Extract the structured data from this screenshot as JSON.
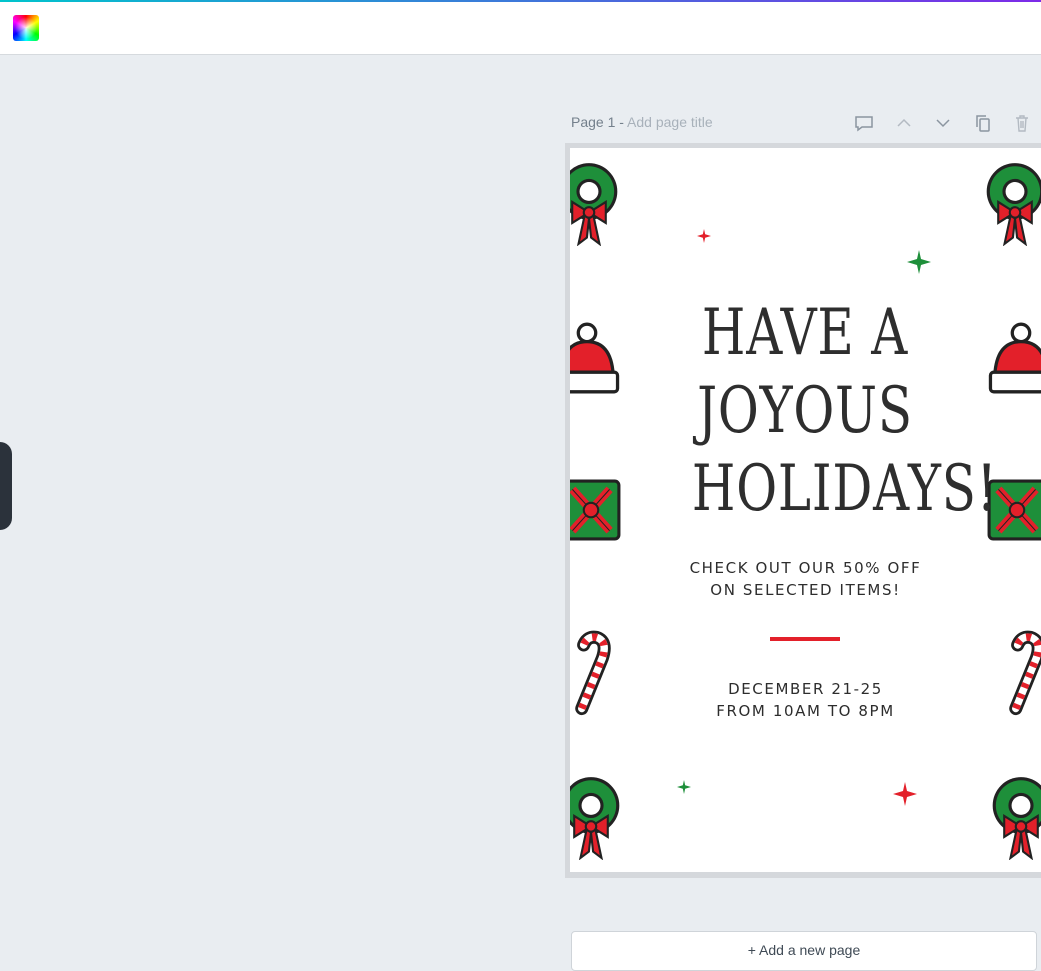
{
  "topbar": {
    "logo_icon": "color-swatch-logo",
    "accent_colors": [
      "#00c4cc",
      "#7d2ae8"
    ]
  },
  "page_header": {
    "page_label": "Page 1 - ",
    "title_placeholder": "Add page title",
    "actions": [
      "comment-icon",
      "move-up-icon",
      "move-down-icon",
      "duplicate-icon",
      "delete-icon"
    ]
  },
  "design": {
    "headline_lines": [
      "HAVE A",
      "JOYOUS",
      "HOLIDAYS!"
    ],
    "offer_lines": [
      "CHECK OUT OUR 50% OFF",
      "ON SELECTED ITEMS!"
    ],
    "date_lines": [
      "DECEMBER 21-25",
      "FROM 10AM TO 8PM"
    ],
    "colors": {
      "red": "#e3202a",
      "green": "#1e8f3a",
      "text": "#2e2e2e"
    },
    "decorations": [
      "wreath-icon",
      "santa-hat-icon",
      "gift-icon",
      "candy-cane-icon",
      "star-icon"
    ]
  },
  "footer": {
    "add_page_label": "+ Add a new page"
  }
}
